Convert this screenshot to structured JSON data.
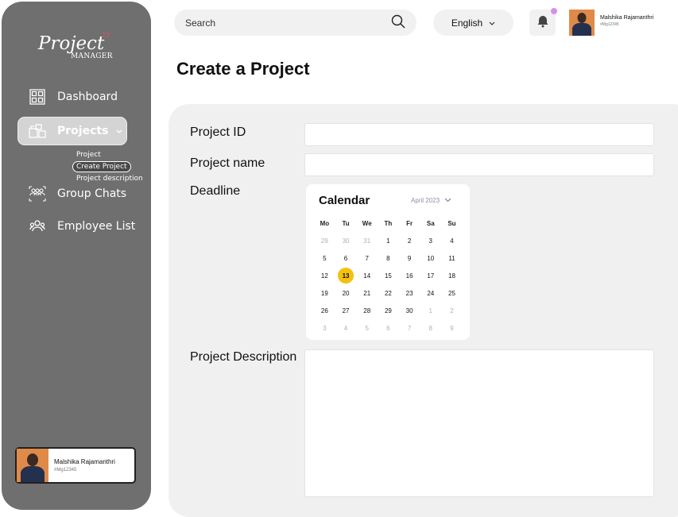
{
  "app": {
    "logo_main": "Project",
    "logo_sup": "23",
    "logo_sub": "MANAGER"
  },
  "sidebar": {
    "items": [
      {
        "label": "Dashboard",
        "icon": "dashboard-icon"
      },
      {
        "label": "Projects",
        "icon": "projects-icon",
        "active": true
      },
      {
        "label": "Group Chats",
        "icon": "group-chat-icon"
      },
      {
        "label": "Employee List",
        "icon": "employees-icon"
      }
    ],
    "subitems": [
      {
        "label": "Project"
      },
      {
        "label": "Create Project",
        "selected": true
      },
      {
        "label": "Project description"
      }
    ],
    "profile": {
      "name": "Malshika Rajamanthri",
      "id": "#Mg12345"
    }
  },
  "header": {
    "search_placeholder": "Search",
    "language": "English",
    "user": {
      "name": "Malshika Rajamanthri",
      "id": "#Mg12345"
    }
  },
  "main": {
    "title": "Create a Project",
    "fields": {
      "project_id": "Project ID",
      "project_name": "Project name",
      "deadline": "Deadline",
      "description": "Project Description"
    }
  },
  "calendar": {
    "title": "Calendar",
    "month": "April 2023",
    "weekdays": [
      "Mo",
      "Tu",
      "We",
      "Th",
      "Fr",
      "Sa",
      "Su"
    ],
    "weeks": [
      [
        "29",
        "30",
        "31",
        "1",
        "2",
        "3",
        "4"
      ],
      [
        "5",
        "6",
        "7",
        "8",
        "9",
        "10",
        "11"
      ],
      [
        "12",
        "13",
        "14",
        "15",
        "16",
        "17",
        "18"
      ],
      [
        "19",
        "20",
        "21",
        "22",
        "23",
        "24",
        "25"
      ],
      [
        "26",
        "27",
        "28",
        "29",
        "30",
        "1",
        "2"
      ],
      [
        "3",
        "4",
        "5",
        "6",
        "7",
        "8",
        "9"
      ]
    ],
    "selected": "13"
  },
  "colors": {
    "sidebar": "#6f6f6f",
    "panel": "#f0f0f0",
    "selected_day": "#f4c20d",
    "notification": "#d88fe8"
  }
}
